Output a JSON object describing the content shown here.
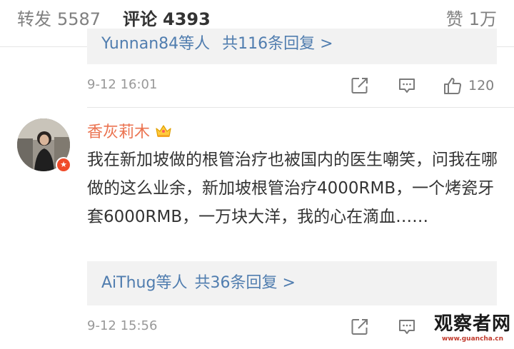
{
  "tabs": {
    "repost": {
      "label": "转发",
      "count": "5587"
    },
    "comment": {
      "label": "评论",
      "count": "4393"
    },
    "like": {
      "label": "赞",
      "count": "1万"
    }
  },
  "comments": [
    {
      "reply_summary": {
        "users": "Yunnan84等人",
        "count_text": "共116条回复 >"
      },
      "time": "9-12 16:01",
      "like_count": "120"
    },
    {
      "username": "香灰莉木",
      "text": "我在新加坡做的根管治疗也被国内的医生嘲笑，问我在哪做的这么业余，新加坡根管治疗4000RMB，一个烤瓷牙套6000RMB，一万块大洋，我的心在滴血……",
      "reply_summary": {
        "users": "AiThug等人",
        "count_text": "共36条回复 >"
      },
      "time": "9-12 15:56"
    }
  ],
  "watermark": {
    "main": "观察者网",
    "sub": "www.guancha.cn"
  },
  "colors": {
    "accent": "#ff8200",
    "link": "#507daf",
    "username": "#eb7350",
    "reply_bg": "#f2f2f2"
  },
  "icons": [
    "share-icon",
    "comment-icon",
    "like-icon",
    "crown-icon",
    "verified-badge-icon"
  ]
}
